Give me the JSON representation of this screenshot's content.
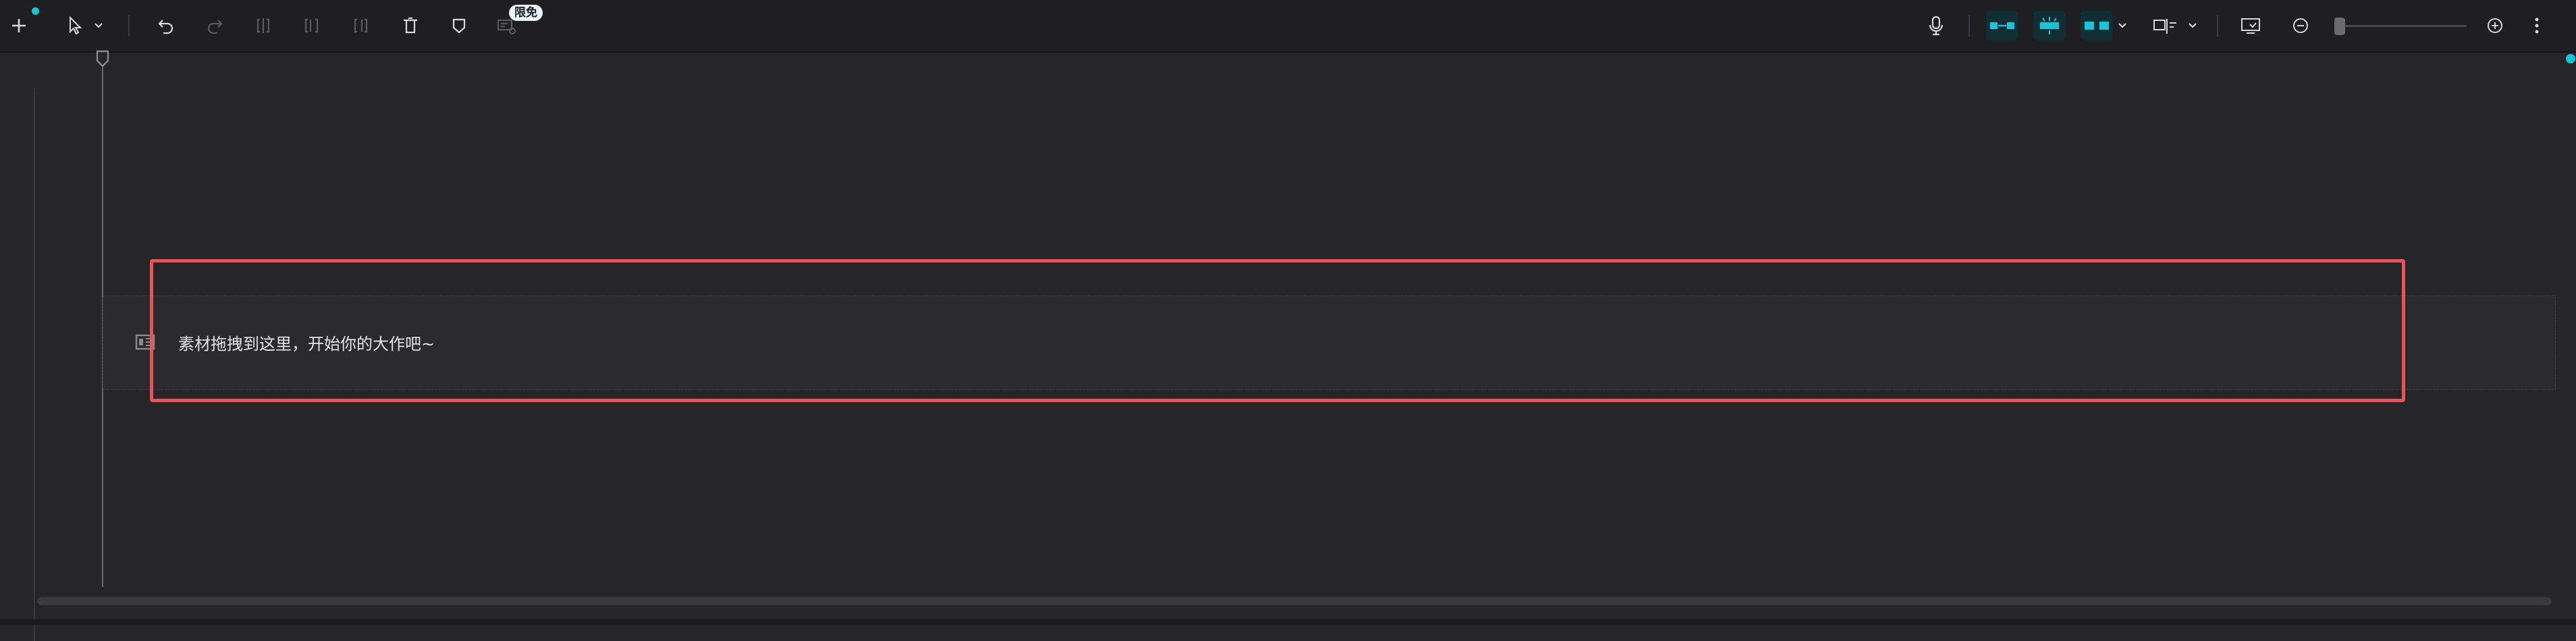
{
  "toolbar": {
    "left_tools": [
      {
        "icon": "plus-icon",
        "label": "add"
      },
      {
        "icon": "cursor-select-icon",
        "label": "select"
      },
      {
        "icon": "chevron-down-icon",
        "label": "select-mode"
      },
      {
        "icon": "undo-icon",
        "label": "undo"
      },
      {
        "icon": "redo-icon",
        "label": "redo"
      },
      {
        "icon": "split-icon",
        "label": "split"
      },
      {
        "icon": "split-left-icon",
        "label": "split-left"
      },
      {
        "icon": "split-right-icon",
        "label": "split-right"
      },
      {
        "icon": "delete-icon",
        "label": "delete"
      },
      {
        "icon": "marker-icon",
        "label": "marker"
      },
      {
        "icon": "smart-tool-icon",
        "label": "smart-tool"
      }
    ],
    "badge_text": "限免",
    "right_tools": [
      {
        "icon": "microphone-icon"
      },
      {
        "icon": "link-clips-icon"
      },
      {
        "icon": "magnet-snap-icon"
      },
      {
        "icon": "link-tracks-icon"
      },
      {
        "icon": "preview-axis-icon"
      },
      {
        "icon": "fullscreen-preview-icon"
      },
      {
        "icon": "zoom-out-icon"
      },
      {
        "icon": "zoom-in-icon"
      },
      {
        "icon": "more-vertical-icon"
      }
    ],
    "zoom_level": 0,
    "accent_color": "#19c4d6"
  },
  "timeline": {
    "drop_hint": "素材拖拽到这里，开始你的大作吧~",
    "drop_icon": "film-strip-icon",
    "highlight_color": "#e8525a"
  }
}
